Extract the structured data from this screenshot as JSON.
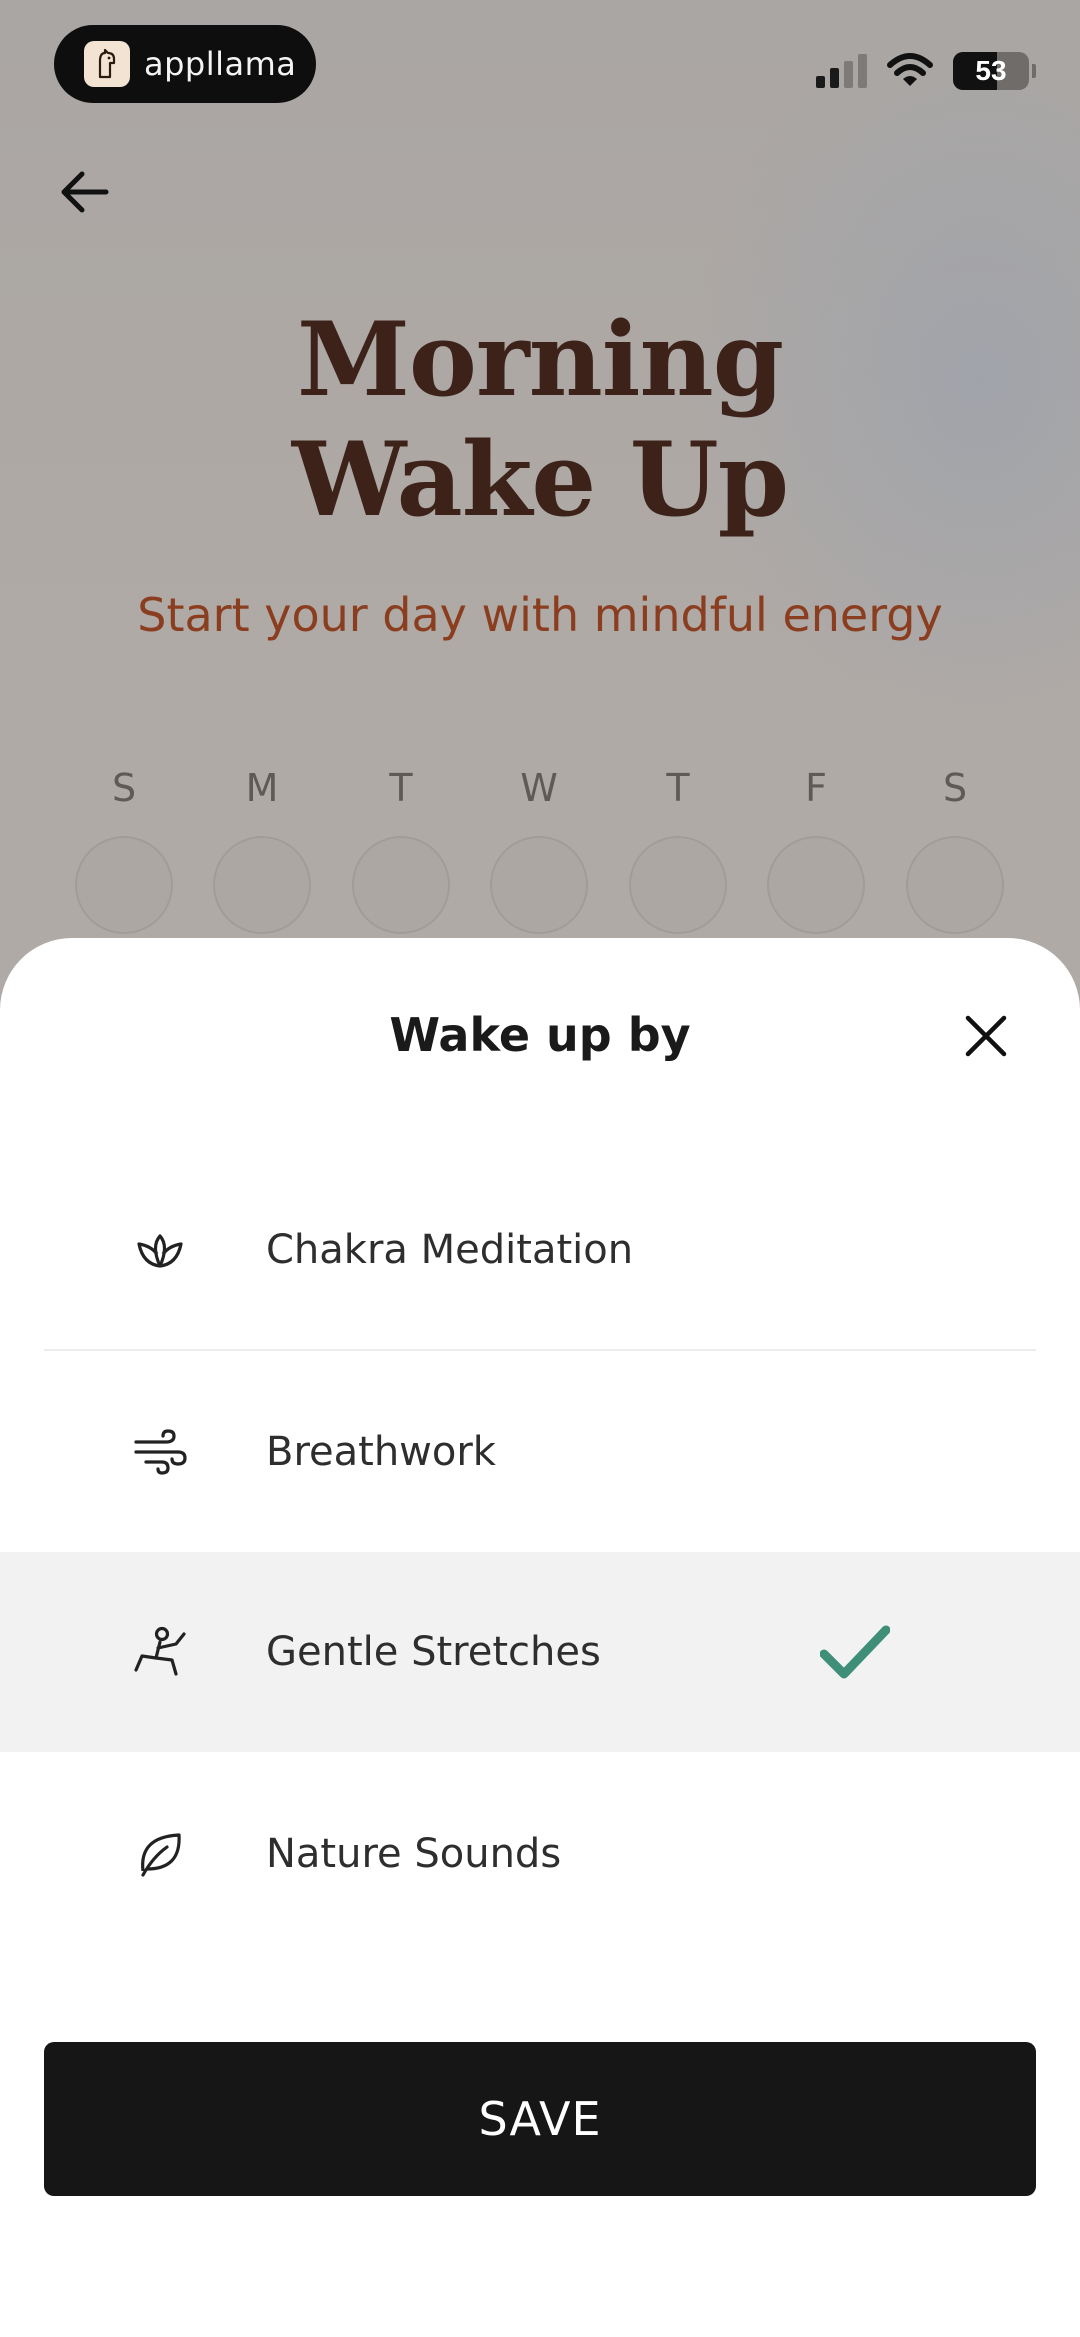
{
  "status_bar": {
    "app_pill_label": "appllama",
    "battery_level": "53",
    "signal_bars_active": 2,
    "signal_bars_total": 4
  },
  "header": {
    "title_line1": "Morning",
    "title_line2": "Wake Up",
    "subtitle": "Start your day with mindful energy"
  },
  "days": [
    "S",
    "M",
    "T",
    "W",
    "T",
    "F",
    "S"
  ],
  "sheet": {
    "title": "Wake up by",
    "options": [
      {
        "label": "Chakra Meditation",
        "icon": "lotus-icon",
        "selected": false
      },
      {
        "label": "Breathwork",
        "icon": "wind-icon",
        "selected": false
      },
      {
        "label": "Gentle Stretches",
        "icon": "stretch-icon",
        "selected": true
      },
      {
        "label": "Nature Sounds",
        "icon": "leaf-icon",
        "selected": false
      }
    ],
    "save_label": "SAVE"
  },
  "colors": {
    "title": "#3d2219",
    "subtitle": "#8a3e1f",
    "check": "#3f8f78",
    "save_button": "#161616"
  }
}
